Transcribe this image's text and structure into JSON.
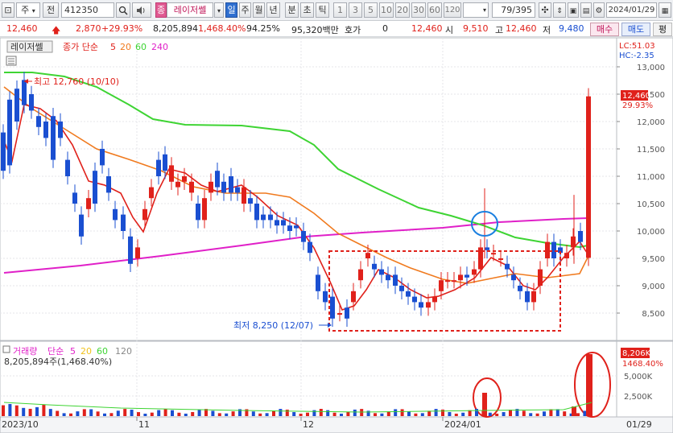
{
  "toolbar": {
    "frame_icon": "⊡",
    "period_select": "주",
    "prev_label": "전",
    "code_value": "412350",
    "search_icon": "search-icon",
    "name_value": "레이저쎌",
    "tag_label": "종",
    "day_label": "일",
    "week_label": "주",
    "month_label": "월",
    "year_label": "년",
    "minute_label": "분",
    "second_label": "초",
    "tick_label": "틱",
    "intervals": [
      "1",
      "3",
      "5",
      "10",
      "20",
      "30",
      "60",
      "120"
    ],
    "count_value": "79/395",
    "date_value": "2024/01/29"
  },
  "quote": {
    "price": "12,460",
    "change": "2,870",
    "change_pct": "+29.93%",
    "volume": "8,205,894",
    "volume_ratio": "1,468.40%",
    "turnover_ratio": "94.25%",
    "amount": "95,320백만",
    "hoga_label": "호가",
    "hoga_value": "0",
    "hoga_price": "12,460",
    "open_label": "시",
    "open_value": "9,510",
    "high_label": "고",
    "high_value": "12,460",
    "low_label": "저",
    "low_value": "9,480",
    "buy_label": "매수",
    "sell_label": "매도",
    "flat_label": "평"
  },
  "chart": {
    "name_tag": "레이저쎌",
    "ma_label": "종가 단순",
    "ma_periods": [
      "5",
      "20",
      "60",
      "240"
    ],
    "lc_label": "LC:51.03",
    "hc_label": "HC:-2.35",
    "y_ticks": [
      "13,000",
      "12,500",
      "12,000",
      "11,500",
      "11,000",
      "10,500",
      "10,000",
      "9,500",
      "9,000",
      "8,500"
    ],
    "last_price_tag": "12,460",
    "last_pct_tag": "29.93%",
    "high_annotation": "최고 12,760 (10/10)",
    "low_annotation": "최저 8,250 (12/07)",
    "colors": {
      "up": "#e0211b",
      "down": "#1a4fd1",
      "ma5": "#e0211b",
      "ma20": "#f07a1e",
      "ma60": "#3ed433",
      "ma240": "#e020c8"
    }
  },
  "volume": {
    "title": "거래량",
    "ma_label": "단순",
    "ma_periods": [
      "5",
      "20",
      "60",
      "120"
    ],
    "value_text": "8,205,894주(1,468.40%)",
    "y_ticks": [
      "5,000K",
      "2,500K"
    ],
    "last_tag": "8,206K",
    "last_pct": "1468.40%"
  },
  "xaxis": {
    "labels": [
      "2023/10",
      "11",
      "12",
      "2024/01"
    ],
    "last_date": "01/29"
  }
}
